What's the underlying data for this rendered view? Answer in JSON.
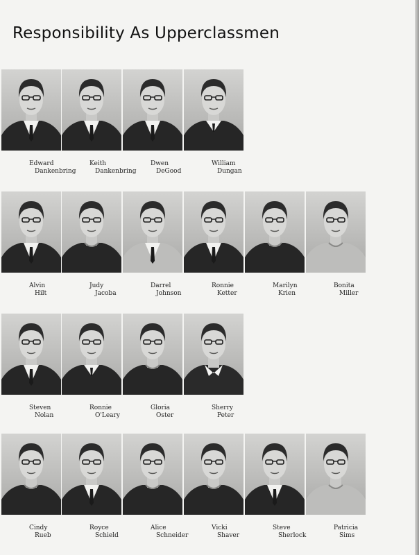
{
  "page": {
    "title": "Responsibility As Upperclassmen"
  },
  "rows": [
    {
      "people": [
        {
          "first": "Edward",
          "last": "Dankenbring",
          "shirt": "suit"
        },
        {
          "first": "Keith",
          "last": "Dankenbring",
          "shirt": "suit"
        },
        {
          "first": "Dwen",
          "last": "DeGood",
          "shirt": "suit"
        },
        {
          "first": "William",
          "last": "Dungan",
          "shirt": "sweater"
        }
      ]
    },
    {
      "people": [
        {
          "first": "Alvin",
          "last": "Hilt",
          "shirt": "suit"
        },
        {
          "first": "Judy",
          "last": "Jacoba",
          "shirt": "blouse"
        },
        {
          "first": "Darrel",
          "last": "Johnson",
          "shirt": "light-suit"
        },
        {
          "first": "Ronnie",
          "last": "Ketter",
          "shirt": "suit"
        },
        {
          "first": "Marilyn",
          "last": "Krien",
          "shirt": "blouse"
        },
        {
          "first": "Bonita",
          "last": "Miller",
          "shirt": "light-blouse"
        }
      ]
    },
    {
      "people": [
        {
          "first": "Steven",
          "last": "Nolan",
          "shirt": "suit"
        },
        {
          "first": "Ronnie",
          "last": "O'Leary",
          "shirt": "sweater"
        },
        {
          "first": "Gloria",
          "last": "Oster",
          "shirt": "blouse"
        },
        {
          "first": "Sherry",
          "last": "Peter",
          "shirt": "collar"
        }
      ]
    },
    {
      "people": [
        {
          "first": "Cindy",
          "last": "Rueb",
          "shirt": "blouse"
        },
        {
          "first": "Royce",
          "last": "Schield",
          "shirt": "suit"
        },
        {
          "first": "Alice",
          "last": "Schneider",
          "shirt": "blouse"
        },
        {
          "first": "Vicki",
          "last": "Shaver",
          "shirt": "blouse"
        },
        {
          "first": "Steve",
          "last": "Sherlock",
          "shirt": "suit"
        },
        {
          "first": "Patricia",
          "last": "Sims",
          "shirt": "light-blouse"
        }
      ]
    }
  ]
}
